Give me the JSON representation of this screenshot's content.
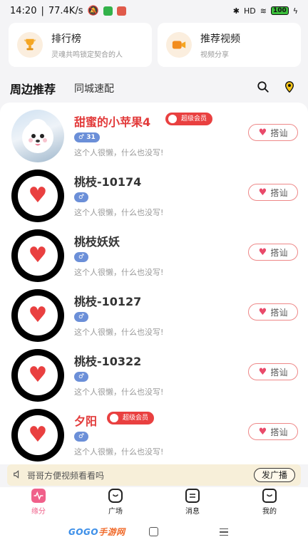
{
  "status_bar": {
    "time": "14:20",
    "speed": "77.4K/s",
    "signal": "HD",
    "battery": "100"
  },
  "top_cards": [
    {
      "title": "排行榜",
      "subtitle": "灵魂共鸣锁定契合的人",
      "icon": "trophy-icon"
    },
    {
      "title": "推荐视频",
      "subtitle": "视频分享",
      "icon": "video-camera-icon"
    }
  ],
  "tabs": {
    "active": "周边推荐",
    "other": "同城速配"
  },
  "users": [
    {
      "name": "甜蜜的小苹果4",
      "vip": true,
      "vip_label": "超级会员",
      "gender": "♂",
      "age": "31",
      "bio": "这个人很懒，什么也没写!",
      "greet": "搭讪",
      "photo": true
    },
    {
      "name": "桃枝-10174",
      "vip": false,
      "gender": "♂",
      "age": "",
      "bio": "这个人很懒，什么也没写!",
      "greet": "搭讪",
      "photo": false
    },
    {
      "name": "桃枝妖妖",
      "vip": false,
      "gender": "♂",
      "age": "",
      "bio": "这个人很懒，什么也没写!",
      "greet": "搭讪",
      "photo": false
    },
    {
      "name": "桃枝-10127",
      "vip": false,
      "gender": "♂",
      "age": "",
      "bio": "这个人很懒，什么也没写!",
      "greet": "搭讪",
      "photo": false
    },
    {
      "name": "桃枝-10322",
      "vip": false,
      "gender": "♂",
      "age": "",
      "bio": "这个人很懒，什么也没写!",
      "greet": "搭讪",
      "photo": false
    },
    {
      "name": "夕阳",
      "vip": true,
      "vip_label": "超级会员",
      "gender": "♂",
      "age": "",
      "bio": "这个人很懒，什么也没写!",
      "greet": "搭讪",
      "photo": false
    }
  ],
  "broadcast": {
    "text": "哥哥方便视频看看吗",
    "button": "发广播"
  },
  "bottom_nav": [
    {
      "label": "缘分",
      "icon": "pulse-icon",
      "active": true
    },
    {
      "label": "广场",
      "icon": "chat-bubble-icon",
      "active": false
    },
    {
      "label": "消息",
      "icon": "message-icon",
      "active": false
    },
    {
      "label": "我的",
      "icon": "profile-icon",
      "active": false
    }
  ],
  "watermark": {
    "brand": "GOGO",
    "suffix": "手游网",
    "url": "www.gogo.cn"
  },
  "colors": {
    "accent": "#f0608a",
    "vip": "#e94040",
    "gender": "#6b8fd8"
  }
}
